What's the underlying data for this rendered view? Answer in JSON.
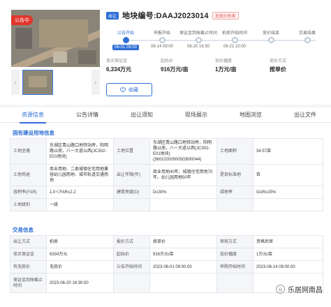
{
  "gallery": {
    "status_tag": "公告中"
  },
  "header": {
    "type_badge": "出让",
    "title": "地块编号:DAAJ2023014",
    "sub_badge": "无底价拍卖"
  },
  "timeline": [
    {
      "label": "公告开始",
      "date": "06-01 09:00",
      "active": true
    },
    {
      "label": "申报开始",
      "date": "06-14 09:00",
      "active": false
    },
    {
      "label": "保证金到账截止时间",
      "date": "06-20 16:30",
      "active": false
    },
    {
      "label": "拍卖开始时间",
      "date": "06-21 10:00",
      "active": false
    },
    {
      "label": "竞价结束",
      "date": "",
      "active": false
    },
    {
      "label": "交易结果",
      "date": "",
      "active": false
    }
  ],
  "stats": [
    {
      "label": "竞买保证金",
      "value": "6,334万元"
    },
    {
      "label": "起始价",
      "value": "916万元/亩"
    },
    {
      "label": "加价幅度",
      "value": "1万元/亩"
    },
    {
      "label": "竞价方式",
      "value": "按单价"
    }
  ],
  "favorite_label": "收藏",
  "tabs": [
    "资源信息",
    "公告详情",
    "出让须知",
    "现场展示",
    "地图浏览",
    "出让文件"
  ],
  "land_section": {
    "title": "国有建设用地信息",
    "rows": [
      [
        "土地坐落",
        "东湖区青山路口地铁站旁，阳明路以南，八一大道以西(JC302-E01地块)",
        "土地位置",
        "东湖区青山路口地铁站旁，阳明路以南，八一大道以西(JC302-E01地块)(360102005005GB00044)",
        "土地面积",
        "34.57亩"
      ],
      [
        "土地用途",
        "商业用地、二类城镇住宅用地兼容幼儿园用地、城市轨道交通用地",
        "出让年限(年)",
        "商业用地40年、城镇住宅用地70年、幼儿园用地50年",
        "是否标准地",
        "否"
      ],
      [
        "容积率(FAR)",
        "1.0＜FAR≤2.2",
        "建筑密度(D)",
        "D≤30%",
        "绿地率",
        "GAR≥25%"
      ],
      [
        "土地级别",
        "一级",
        "",
        "",
        "",
        ""
      ]
    ]
  },
  "trade_section": {
    "title": "交易信息",
    "rows": [
      [
        "出让方式",
        "拍卖",
        "报价方式",
        "按单价",
        "审核方式",
        "资格后审"
      ],
      [
        "竞买保证金",
        "6334万元",
        "起始价",
        "916万元/亩",
        "加价幅度",
        "1万元/亩"
      ],
      [
        "有无底价",
        "无底价",
        "公告开始时间",
        "2023-06-01 09:00:00",
        "申购开始时间",
        "2023-06-14 09:00:00"
      ],
      [
        "保证金到账截止时间",
        "2023-06-20 16:30:00",
        "",
        "",
        "",
        ""
      ]
    ]
  },
  "watermark": "乐居网南昌"
}
